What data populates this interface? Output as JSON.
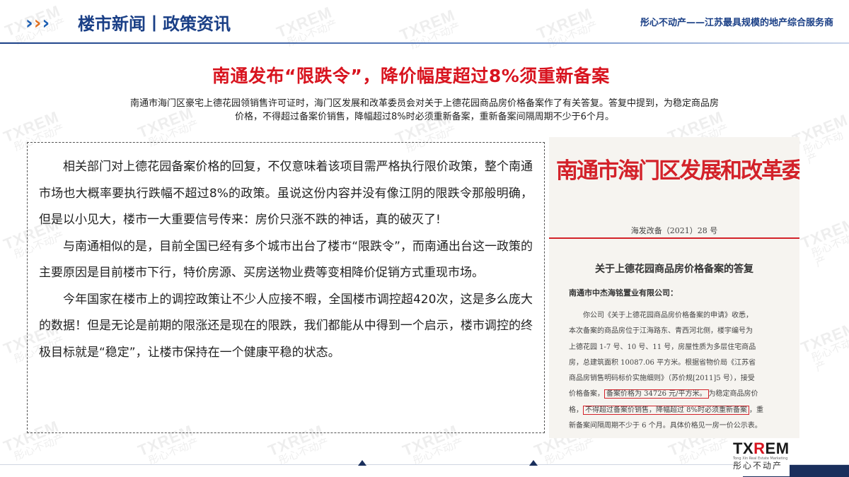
{
  "header": {
    "section_title": "楼市新闻丨政策资讯",
    "company_tagline": "彤心不动产——江苏最具规模的地产综合服务商"
  },
  "watermark": {
    "brand": "TXREM",
    "cn": "彤心不动产"
  },
  "headline": "南通发布“限跌令”，降价幅度超过8%须重新备案",
  "summary": [
    "南通市海门区豪宅上德花园领销售许可证时，海门区发展和改革委员会对关于上德花园商品房价格备案作了有关答复。答复中提到，为稳定商品房",
    "价格，不得超过备案价销售，降幅超过8%时必须重新备案，重新备案间隔周期不少于6个月。"
  ],
  "article": {
    "paragraphs": [
      "相关部门对上德花园备案价格的回复，不仅意味着该项目需严格执行限价政策，整个南通市场也大概率要执行跌幅不超过8%的政策。虽说这份内容并没有像江阴的限跌令那般明确，但是以小见大，楼市一大重要信号传来：房价只涨不跌的神话，真的破灭了!",
      "与南通相似的是，目前全国已经有多个城市出台了楼市“限跌令”，而南通出台这一政策的主要原因是目前楼市下行，特价房源、买房送物业费等变相降价促销方式重现市场。",
      "今年国家在楼市上的调控政策让不少人应接不暇，全国楼市调控超420次，这是多么庞大的数据！但是无论是前期的限涨还是现在的限跌，我们都能从中得到一个启示，楼市调控的终极目标就是“稳定”，让楼市保持在一个健康平稳的状态。"
    ]
  },
  "document": {
    "issuer": "南通市海门区发展和改革委员会",
    "number": "海发改备（2021）28 号",
    "title": "关于上德花园商品房价格备案的答复",
    "addressee": "南通市中杰海铭置业有限公司：",
    "body_lines": [
      "你公司《关于上德花园商品房价格备案的申请》收悉，",
      "本次备案的商品房位于江海路东、青西河北侧，楼宇编号为",
      "上德花园 1-7 号、10 号、11 号，房屋性质为多层住宅商品",
      "房，总建筑面积 10087.06 平方米。根据省物价局《江苏省",
      "商品房销售明码标价实施细则》（苏价规[2011]5 号），接受"
    ],
    "line6_pre": "价格备案，",
    "line6_boxed": "备案价格为 34726 元/平方米。",
    "line6_post": "为稳定商品房价",
    "line7_pre": "格，",
    "line7_boxed": "不得超过备案价销售，降幅超过 8%时必须重新备案",
    "line7_post": "，重",
    "line8": "新备案间隔周期不少于 6 个月。具体价格见一房一价公示表。"
  },
  "logo": {
    "brand_prefix": "TX",
    "brand_accent": "R",
    "brand_suffix": "EM",
    "tagline": "Tong Xin Real Estate Marketing",
    "cn_name": "彤心不动产"
  }
}
